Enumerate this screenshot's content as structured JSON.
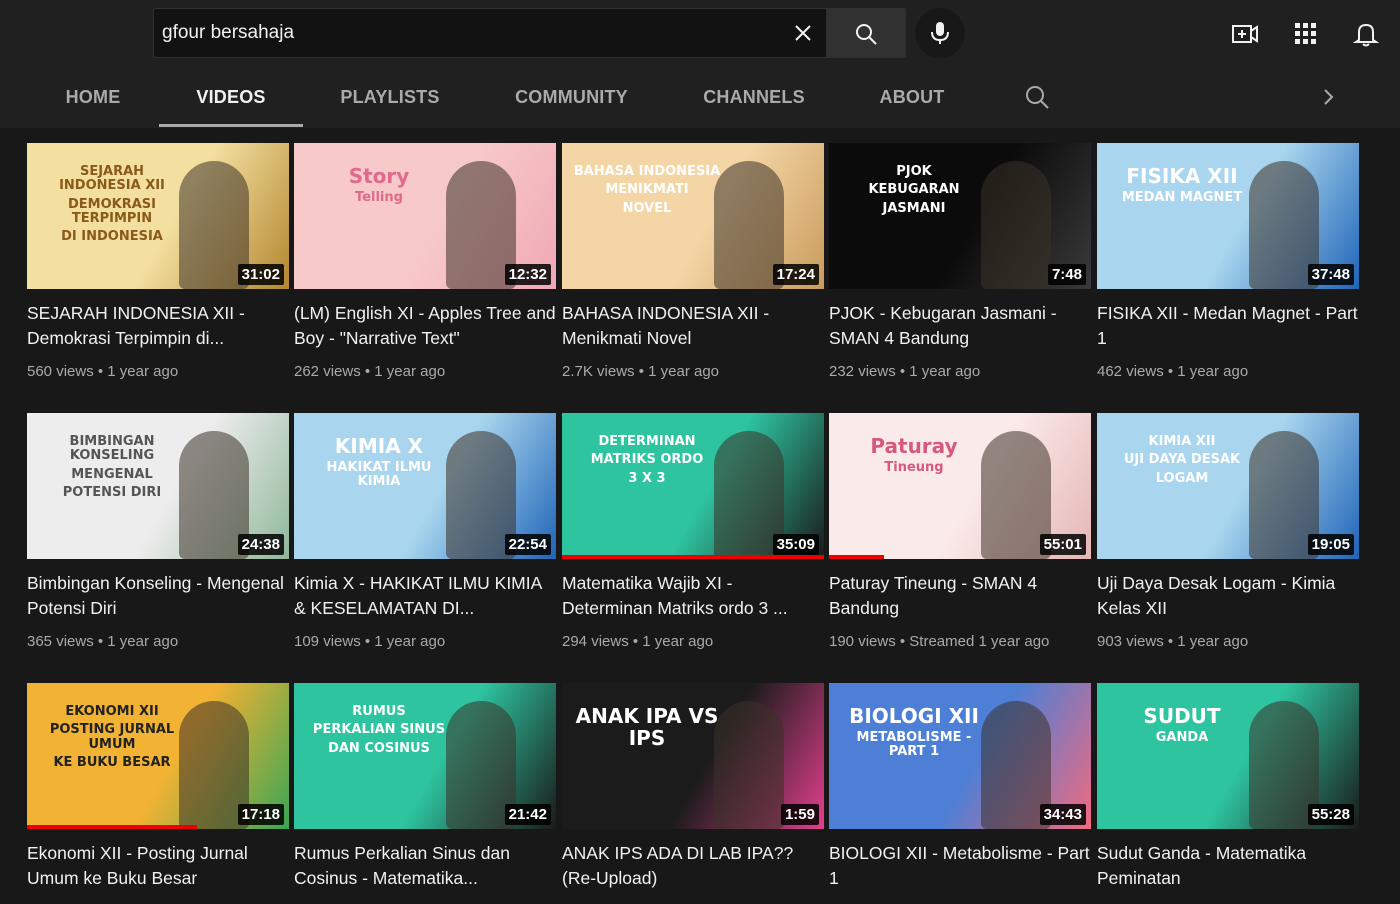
{
  "search": {
    "value": "gfour bersahaja",
    "placeholder": "Search"
  },
  "header_icons": [
    "create-video-icon",
    "apps-grid-icon",
    "notifications-bell-icon"
  ],
  "tabs": [
    {
      "label": "HOME"
    },
    {
      "label": "VIDEOS",
      "active": true
    },
    {
      "label": "PLAYLISTS"
    },
    {
      "label": "COMMUNITY"
    },
    {
      "label": "CHANNELS"
    },
    {
      "label": "ABOUT"
    }
  ],
  "videos": [
    {
      "title": "SEJARAH INDONESIA XII - Demokrasi Terpimpin di...",
      "views": "560 views",
      "age": "1 year ago",
      "duration": "31:02",
      "thumb": {
        "bg": "#f3dfa0",
        "accent": "#b3872f",
        "lines": [
          "SEJARAH INDONESIA XII",
          "DEMOKRASI TERPIMPIN",
          "DI INDONESIA"
        ],
        "text_color": "#8a5a1a"
      }
    },
    {
      "title": "(LM) English XI - Apples Tree and Boy - \"Narrative Text\"",
      "views": "262 views",
      "age": "1 year ago",
      "duration": "12:32",
      "thumb": {
        "bg": "#f7c9c9",
        "accent": "#f0a8b5",
        "lines": [
          "Story",
          "Telling"
        ],
        "text_color": "#e06a8a"
      }
    },
    {
      "title": "BAHASA INDONESIA XII - Menikmati Novel",
      "views": "2.7K views",
      "age": "1 year ago",
      "duration": "17:24",
      "thumb": {
        "bg": "#f4d6a6",
        "accent": "#c99b5c",
        "lines": [
          "BAHASA INDONESIA",
          "MENIKMATI",
          "NOVEL"
        ],
        "text_color": "#ffffff"
      }
    },
    {
      "title": "PJOK - Kebugaran Jasmani - SMAN 4 Bandung",
      "views": "232 views",
      "age": "1 year ago",
      "duration": "7:48",
      "thumb": {
        "bg": "#0b0b0b",
        "accent": "#3a3a3a",
        "lines": [
          "PJOK",
          "KEBUGARAN",
          "JASMANI"
        ],
        "text_color": "#ffffff"
      }
    },
    {
      "title": "FISIKA XII - Medan Magnet - Part 1",
      "views": "462 views",
      "age": "1 year ago",
      "duration": "37:48",
      "thumb": {
        "bg": "#a9d6ee",
        "accent": "#1f64b8",
        "lines": [
          "FISIKA XII",
          "MEDAN MAGNET"
        ],
        "text_color": "#ffffff"
      }
    },
    {
      "title": "Bimbingan Konseling - Mengenal Potensi Diri",
      "views": "365 views",
      "age": "1 year ago",
      "duration": "24:38",
      "thumb": {
        "bg": "#ededed",
        "accent": "#8fb79a",
        "lines": [
          "BIMBINGAN KONSELING",
          "MENGENAL",
          "POTENSI DIRI"
        ],
        "text_color": "#555555"
      }
    },
    {
      "title": "Kimia X - HAKIKAT ILMU KIMIA & KESELAMATAN DI...",
      "views": "109 views",
      "age": "1 year ago",
      "duration": "22:54",
      "thumb": {
        "bg": "#a9d6ee",
        "accent": "#1f64b8",
        "lines": [
          "KIMIA X",
          "HAKIKAT ILMU KIMIA"
        ],
        "text_color": "#ffffff"
      }
    },
    {
      "title": "Matematika Wajib XI - Determinan Matriks ordo 3 ...",
      "views": "294 views",
      "age": "1 year ago",
      "duration": "35:09",
      "thumb": {
        "bg": "#2ec4a0",
        "accent": "#1a1a1a",
        "lines": [
          "DETERMINAN",
          "MATRIKS ORDO",
          "3 X 3"
        ],
        "text_color": "#ffffff"
      }
    },
    {
      "title": "Paturay Tineung - SMAN 4 Bandung",
      "views": "190 views",
      "age": "Streamed 1 year ago",
      "duration": "55:01",
      "thumb": {
        "bg": "#fbeaea",
        "accent": "#e5b6b6",
        "lines": [
          "Paturay",
          "Tineung"
        ],
        "text_color": "#d65b7a"
      }
    },
    {
      "title": "Uji Daya Desak Logam - Kimia Kelas XII",
      "views": "903 views",
      "age": "1 year ago",
      "duration": "19:05",
      "thumb": {
        "bg": "#a9d6ee",
        "accent": "#1f64b8",
        "lines": [
          "KIMIA XII",
          "UJI DAYA DESAK",
          "LOGAM"
        ],
        "text_color": "#ffffff"
      }
    },
    {
      "title": "Ekonomi XII - Posting Jurnal Umum ke Buku Besar",
      "views": "",
      "age": "",
      "duration": "17:18",
      "thumb": {
        "bg": "#f2b233",
        "accent": "#3aa655",
        "lines": [
          "EKONOMI XII",
          "POSTING JURNAL UMUM",
          "KE BUKU BESAR"
        ],
        "text_color": "#222222"
      }
    },
    {
      "title": "Rumus Perkalian Sinus dan Cosinus - Matematika...",
      "views": "",
      "age": "",
      "duration": "21:42",
      "thumb": {
        "bg": "#2ec4a0",
        "accent": "#1a1a1a",
        "lines": [
          "RUMUS",
          "PERKALIAN SINUS",
          "DAN COSINUS"
        ],
        "text_color": "#ffffff"
      }
    },
    {
      "title": "ANAK IPS ADA DI LAB IPA?? (Re-Upload)",
      "views": "",
      "age": "",
      "duration": "1:59",
      "thumb": {
        "bg": "#1b1b1b",
        "accent": "#e43f8e",
        "lines": [
          "ANAK IPA VS IPS"
        ],
        "text_color": "#ffffff"
      }
    },
    {
      "title": "BIOLOGI XII - Metabolisme - Part 1",
      "views": "",
      "age": "",
      "duration": "34:43",
      "thumb": {
        "bg": "#4d7fd6",
        "accent": "#f26a7f",
        "lines": [
          "BIOLOGI XII",
          "METABOLISME - PART 1"
        ],
        "text_color": "#ffffff"
      }
    },
    {
      "title": "Sudut Ganda - Matematika Peminatan",
      "views": "",
      "age": "",
      "duration": "55:28",
      "thumb": {
        "bg": "#2ec4a0",
        "accent": "#1a1a1a",
        "lines": [
          "SUDUT",
          "GANDA"
        ],
        "text_color": "#ffffff"
      }
    }
  ]
}
